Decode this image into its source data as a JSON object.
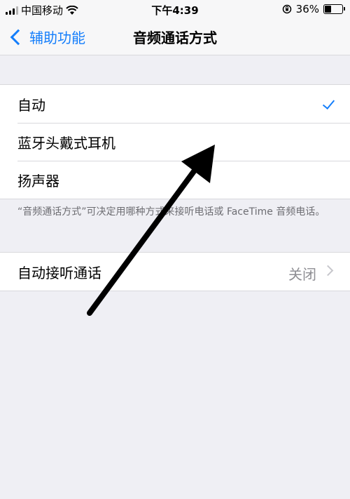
{
  "status_bar": {
    "carrier": "中国移动",
    "time": "下午4:39",
    "battery": "36%"
  },
  "nav": {
    "back_label": "辅助功能",
    "title": "音频通话方式"
  },
  "audio_routing": {
    "options": [
      {
        "label": "自动",
        "selected": true
      },
      {
        "label": "蓝牙头戴式耳机",
        "selected": false
      },
      {
        "label": "扬声器",
        "selected": false
      }
    ],
    "footer": "“音频通话方式”可决定用哪种方式来接听电话或 FaceTime 音频电话。"
  },
  "auto_answer": {
    "label": "自动接听通话",
    "value": "关闭"
  },
  "colors": {
    "accent": "#147efb",
    "background": "#efeff4",
    "secondary_text": "#8e8e93",
    "annotation_arrow": "#000000"
  }
}
